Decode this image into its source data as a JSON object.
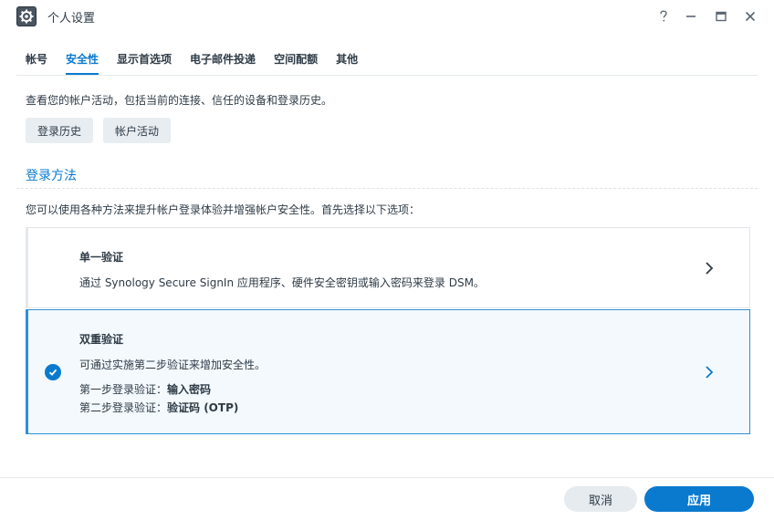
{
  "window": {
    "title": "个人设置",
    "help_icon": "help-icon",
    "minimize_icon": "minimize-icon",
    "maximize_icon": "maximize-icon",
    "close_icon": "close-icon"
  },
  "tabs": [
    {
      "label": "帐号",
      "active": false
    },
    {
      "label": "安全性",
      "active": true
    },
    {
      "label": "显示首选项",
      "active": false
    },
    {
      "label": "电子邮件投递",
      "active": false
    },
    {
      "label": "空间配额",
      "active": false
    },
    {
      "label": "其他",
      "active": false
    }
  ],
  "activity": {
    "description": "查看您的帐户活动，包括当前的连接、信任的设备和登录历史。",
    "login_history_label": "登录历史",
    "account_activity_label": "帐户活动"
  },
  "login_method": {
    "title": "登录方法",
    "description": "您可以使用各种方法来提升帐户登录体验并增强帐户安全性。首先选择以下选项：",
    "options": [
      {
        "title": "单一验证",
        "text": "通过 Synology Secure SignIn 应用程序、硬件安全密钥或输入密码来登录 DSM。",
        "selected": false
      },
      {
        "title": "双重验证",
        "text": "可通过实施第二步验证来增加安全性。",
        "step1_label": "第一步登录验证：",
        "step1_value": "输入密码",
        "step2_label": "第二步登录验证：",
        "step2_value": "验证码 (OTP)",
        "selected": true
      }
    ]
  },
  "footer": {
    "cancel_label": "取消",
    "apply_label": "应用"
  },
  "colors": {
    "accent": "#0a7acf",
    "selected_border": "#2f8fd9",
    "selected_bg": "#f4f9fd"
  }
}
